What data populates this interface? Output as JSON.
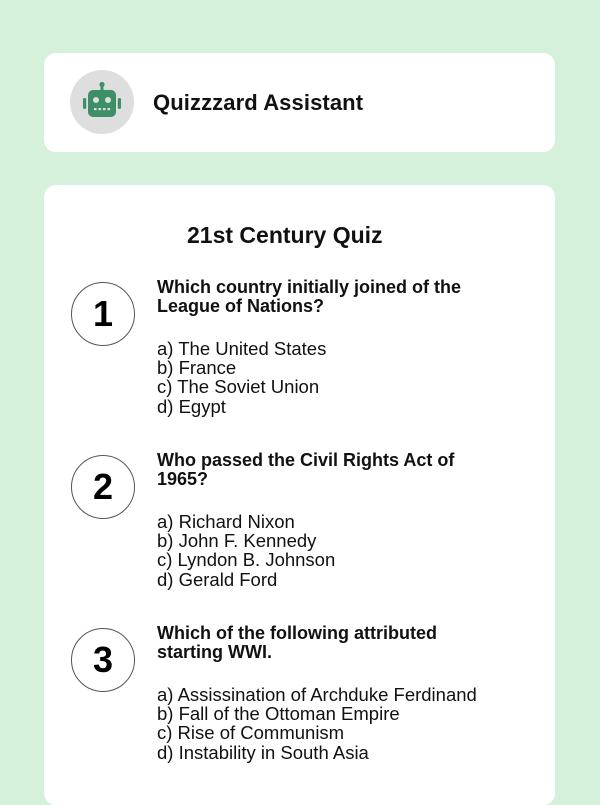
{
  "assistant": {
    "name": "Quizzzard Assistant",
    "avatar_icon": "robot-icon",
    "avatar_color": "#3d8f68"
  },
  "quiz": {
    "title": "21st Century Quiz",
    "questions": [
      {
        "number": "1",
        "text": "Which country initially joined of the League of Nations?",
        "options": [
          "a) The United States",
          "b) France",
          "c) The Soviet Union",
          "d) Egypt"
        ]
      },
      {
        "number": "2",
        "text": "Who passed the Civil Rights Act of 1965?",
        "options": [
          "a) Richard Nixon",
          "b) John F. Kennedy",
          "c) Lyndon B. Johnson",
          "d) Gerald Ford"
        ]
      },
      {
        "number": "3",
        "text": "Which of the following attributed starting WWI.",
        "options": [
          "a) Assissination of Archduke Ferdinand",
          "b) Fall of the Ottoman Empire",
          "c) Rise of Communism",
          "d) Instability in South Asia"
        ]
      }
    ]
  }
}
